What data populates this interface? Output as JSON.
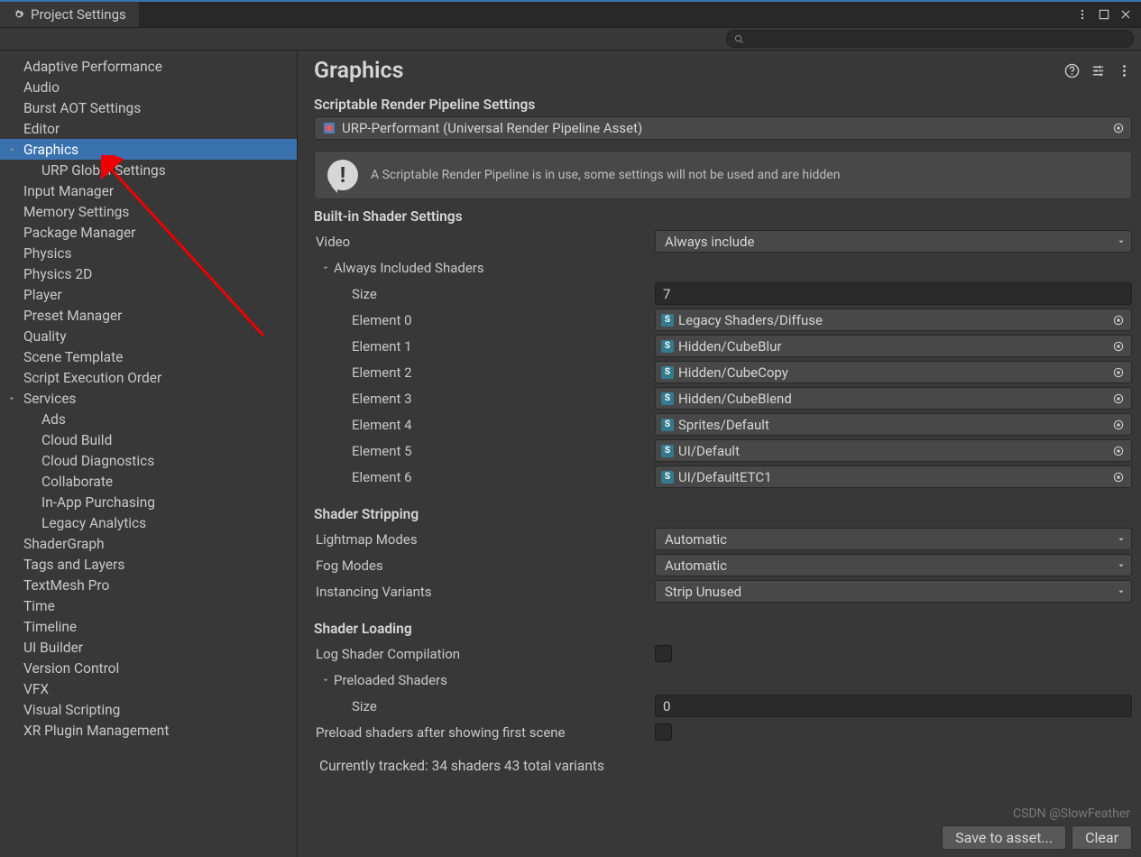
{
  "tab_title": "Project Settings",
  "search_placeholder": "",
  "sidebar": {
    "items": [
      {
        "label": "Adaptive Performance",
        "depth": 0
      },
      {
        "label": "Audio",
        "depth": 0
      },
      {
        "label": "Burst AOT Settings",
        "depth": 0
      },
      {
        "label": "Editor",
        "depth": 0
      },
      {
        "label": "Graphics",
        "depth": 0,
        "selected": true,
        "caret": "down"
      },
      {
        "label": "URP Global Settings",
        "depth": 1
      },
      {
        "label": "Input Manager",
        "depth": 0
      },
      {
        "label": "Memory Settings",
        "depth": 0
      },
      {
        "label": "Package Manager",
        "depth": 0
      },
      {
        "label": "Physics",
        "depth": 0
      },
      {
        "label": "Physics 2D",
        "depth": 0
      },
      {
        "label": "Player",
        "depth": 0
      },
      {
        "label": "Preset Manager",
        "depth": 0
      },
      {
        "label": "Quality",
        "depth": 0
      },
      {
        "label": "Scene Template",
        "depth": 0
      },
      {
        "label": "Script Execution Order",
        "depth": 0
      },
      {
        "label": "Services",
        "depth": 0,
        "caret": "down"
      },
      {
        "label": "Ads",
        "depth": 1
      },
      {
        "label": "Cloud Build",
        "depth": 1
      },
      {
        "label": "Cloud Diagnostics",
        "depth": 1
      },
      {
        "label": "Collaborate",
        "depth": 1
      },
      {
        "label": "In-App Purchasing",
        "depth": 1
      },
      {
        "label": "Legacy Analytics",
        "depth": 1
      },
      {
        "label": "ShaderGraph",
        "depth": 0
      },
      {
        "label": "Tags and Layers",
        "depth": 0
      },
      {
        "label": "TextMesh Pro",
        "depth": 0
      },
      {
        "label": "Time",
        "depth": 0
      },
      {
        "label": "Timeline",
        "depth": 0
      },
      {
        "label": "UI Builder",
        "depth": 0
      },
      {
        "label": "Version Control",
        "depth": 0
      },
      {
        "label": "VFX",
        "depth": 0
      },
      {
        "label": "Visual Scripting",
        "depth": 0
      },
      {
        "label": "XR Plugin Management",
        "depth": 0
      }
    ]
  },
  "header": {
    "title": "Graphics"
  },
  "srp": {
    "heading": "Scriptable Render Pipeline Settings",
    "asset": "URP-Performant (Universal Render Pipeline Asset)"
  },
  "info": "A Scriptable Render Pipeline is in use, some settings will not be used and are hidden",
  "builtin": {
    "heading": "Built-in Shader Settings",
    "video_label": "Video",
    "video_value": "Always include",
    "ais_label": "Always Included Shaders",
    "size_label": "Size",
    "size_value": "7",
    "elements": [
      {
        "label": "Element 0",
        "value": "Legacy Shaders/Diffuse"
      },
      {
        "label": "Element 1",
        "value": "Hidden/CubeBlur"
      },
      {
        "label": "Element 2",
        "value": "Hidden/CubeCopy"
      },
      {
        "label": "Element 3",
        "value": "Hidden/CubeBlend"
      },
      {
        "label": "Element 4",
        "value": "Sprites/Default"
      },
      {
        "label": "Element 5",
        "value": "UI/Default"
      },
      {
        "label": "Element 6",
        "value": "UI/DefaultETC1"
      }
    ]
  },
  "stripping": {
    "heading": "Shader Stripping",
    "lightmap_label": "Lightmap Modes",
    "lightmap_value": "Automatic",
    "fog_label": "Fog Modes",
    "fog_value": "Automatic",
    "instancing_label": "Instancing Variants",
    "instancing_value": "Strip Unused"
  },
  "loading": {
    "heading": "Shader Loading",
    "log_label": "Log Shader Compilation",
    "preloaded_label": "Preloaded Shaders",
    "size_label": "Size",
    "size_value": "0",
    "preload_after_label": "Preload shaders after showing first scene"
  },
  "status": "Currently tracked: 34 shaders 43 total variants",
  "buttons": {
    "save": "Save to asset...",
    "clear": "Clear"
  },
  "watermark": "CSDN @SlowFeather"
}
